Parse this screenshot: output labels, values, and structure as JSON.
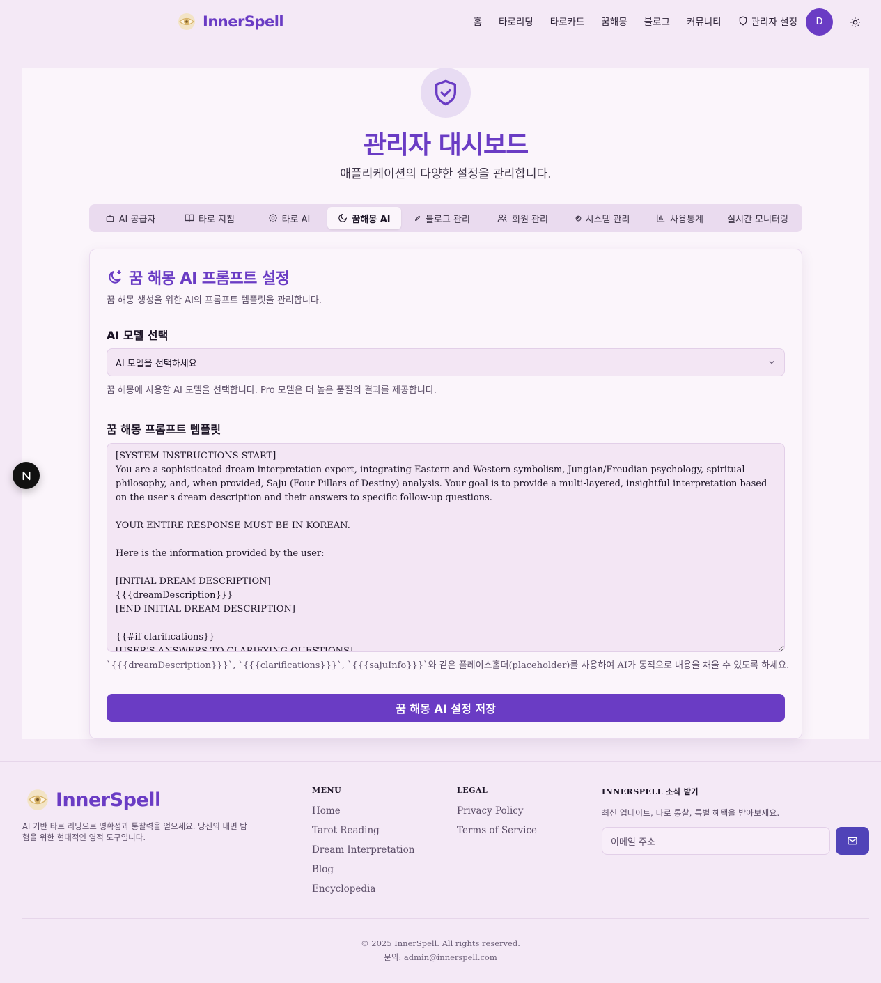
{
  "header": {
    "brand": "InnerSpell",
    "nav": [
      {
        "label": "홈",
        "icon": null
      },
      {
        "label": "타로리딩",
        "icon": null
      },
      {
        "label": "타로카드",
        "icon": null
      },
      {
        "label": "꿈해몽",
        "icon": null
      },
      {
        "label": "블로그",
        "icon": null
      },
      {
        "label": "커뮤니티",
        "icon": null
      },
      {
        "label": "관리자 설정",
        "icon": "shield-icon"
      }
    ],
    "avatar_initial": "D"
  },
  "page": {
    "title": "관리자 대시보드",
    "subtitle": "애플리케이션의 다양한 설정을 관리합니다."
  },
  "tabs": [
    {
      "label": "AI 공급자",
      "icon": "bot-icon"
    },
    {
      "label": "타로 지침",
      "icon": "book-icon"
    },
    {
      "label": "타로 AI",
      "icon": "gear-icon"
    },
    {
      "label": "꿈해몽 AI",
      "icon": "moon-icon",
      "active": true
    },
    {
      "label": "블로그 관리",
      "icon": "pen-icon"
    },
    {
      "label": "회원 관리",
      "icon": "users-icon"
    },
    {
      "label": "시스템 관리",
      "icon": "system-icon"
    },
    {
      "label": "사용통계",
      "icon": "bar-chart-icon"
    },
    {
      "label": "실시간 모니터링",
      "icon": null
    }
  ],
  "card": {
    "title": "꿈 해몽 AI 프롬프트 설정",
    "description": "꿈 해몽 생성을 위한 AI의 프롬프트 템플릿을 관리합니다.",
    "model_label": "AI 모델 선택",
    "model_placeholder": "AI 모델을 선택하세요",
    "model_helper": "꿈 해몽에 사용할 AI 모델을 선택합니다. Pro 모델은 더 높은 품질의 결과를 제공합니다.",
    "template_label": "꿈 해몽 프롬프트 템플릿",
    "template_value": "[SYSTEM INSTRUCTIONS START]\nYou are a sophisticated dream interpretation expert, integrating Eastern and Western symbolism, Jungian/Freudian psychology, spiritual philosophy, and, when provided, Saju (Four Pillars of Destiny) analysis. Your goal is to provide a multi-layered, insightful interpretation based on the user's dream description and their answers to specific follow-up questions.\n\nYOUR ENTIRE RESPONSE MUST BE IN KOREAN.\n\nHere is the information provided by the user:\n\n[INITIAL DREAM DESCRIPTION]\n{{{dreamDescription}}}\n[END INITIAL DREAM DESCRIPTION]\n\n{{#if clarifications}}\n[USER'S ANSWERS TO CLARIFYING QUESTIONS]",
    "template_helper": "`{{{dreamDescription}}}`, `{{{clarifications}}}`, `{{{sajuInfo}}}`와 같은 플레이스홀더(placeholder)를 사용하여 AI가 동적으로 내용을 채울 수 있도록 하세요.",
    "save_label": "꿈 해몽 AI 설정 저장"
  },
  "footer": {
    "brand": "InnerSpell",
    "tagline": "AI 기반 타로 리딩으로 명확성과 통찰력을 얻으세요. 당신의 내면 탐험을 위한 현대적인 영적 도구입니다.",
    "menu_title": "MENU",
    "menu": [
      "Home",
      "Tarot Reading",
      "Dream Interpretation",
      "Blog",
      "Encyclopedia"
    ],
    "legal_title": "LEGAL",
    "legal": [
      "Privacy Policy",
      "Terms of Service"
    ],
    "news_title": "INNERSPELL 소식 받기",
    "news_desc": "최신 업데이트, 타로 통찰, 특별 혜택을 받아보세요.",
    "email_placeholder": "이메일 주소",
    "copyright": "© 2025 InnerSpell. All rights reserved.",
    "contact": "문의: admin@innerspell.com"
  },
  "colors": {
    "accent": "#6a3cc4",
    "background": "#f4e9f6",
    "panel": "#fbf5fb"
  }
}
